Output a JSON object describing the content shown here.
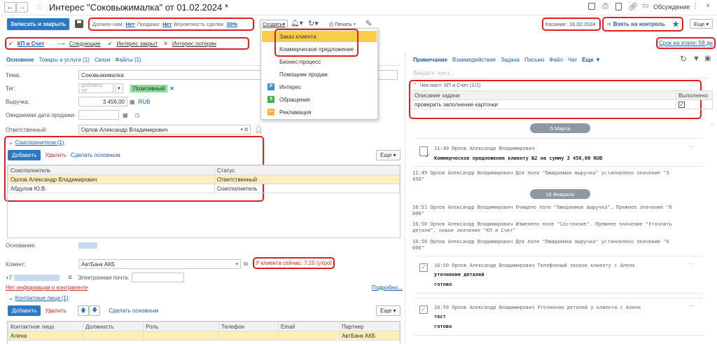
{
  "window": {
    "title": "Интерес \"Соковыжималка\" от 01.02.2024 *",
    "discussion_label": "Обсуждение"
  },
  "toolbar": {
    "save_close": "Записать и закрыть",
    "owes_us_label": "Должен нам:",
    "owes_us_value": "Нет",
    "sales_label": "Продажи:",
    "sales_value": "Нет",
    "probability_label": "Вероятность сделки:",
    "probability_value": "30%",
    "create_label": "Создать",
    "print_label": "Печать",
    "touch_label": "Касание:",
    "touch_value": "16.02.2024",
    "control_label": "Взять на контроль",
    "more_label": "Еще"
  },
  "create_menu": {
    "items": [
      {
        "label": "Заказ клиента",
        "icon": ""
      },
      {
        "label": "Коммерческое предложение",
        "icon": ""
      },
      {
        "label": "Бизнес-процесс",
        "icon": ""
      },
      {
        "label": "Помощник продаж",
        "icon": ""
      },
      {
        "label": "Интерес",
        "icon": "P"
      },
      {
        "label": "Обращение",
        "icon": "Х"
      },
      {
        "label": "Рекламация",
        "icon": "—"
      }
    ]
  },
  "stages": {
    "current": "КП и Счет",
    "next": "Следующие",
    "closed": "Интерес закрыт",
    "lost": "Интерес потерян",
    "stage_time": "Срок на этапе: 58 дн"
  },
  "tabs": [
    "Основное",
    "Товары и услуги (1)",
    "Связи",
    "Файлы (1)"
  ],
  "form": {
    "topic_label": "Тема:",
    "topic_value": "Соковыжималка",
    "tag_label": "Тег:",
    "tag_placeholder": "Добавить тег",
    "tag_value": "Позитивный",
    "revenue_label": "Выручка:",
    "revenue_value": "3 456,00",
    "currency": "RUB",
    "sale_date_label": "Ожидаемая дата продажи:",
    "sale_date_value": ". .",
    "responsible_label": "Ответственный:",
    "responsible_value": "Орлов Александр Владимирович",
    "basis_label": "Основание:",
    "client_label": "Клиент:",
    "client_value": "АвтБанк АКБ",
    "client_time": "У клиента сейчас: 7:10 (утро)",
    "phone_prefix": "+7",
    "email_label": "Электронная почта:",
    "no_info": "Нет информации о контрагенте",
    "more_link": "Подробно..."
  },
  "coexecutors": {
    "title": "Соисполнители (1)",
    "add": "Добавить",
    "delete": "Удалить",
    "make_main": "Сделать основным",
    "more": "Еще",
    "columns": [
      "Соисполнитель",
      "Статус"
    ],
    "rows": [
      [
        "Орлов Александр Владимирович",
        "Ответственный"
      ],
      [
        "Абдулов Ю.В.",
        "Соисполнитель"
      ]
    ]
  },
  "contacts": {
    "title": "Контактные лица (1)",
    "add": "Добавить",
    "delete": "Удалить",
    "make_main": "Сделать основным",
    "more": "Еще",
    "columns": [
      "Контактное лицо",
      "Должность",
      "Роль",
      "Телефон",
      "Email",
      "Партнер"
    ],
    "rows": [
      [
        "Алена",
        "",
        "",
        "",
        "",
        "АвтБанк АКБ"
      ]
    ]
  },
  "right_tabs": [
    "Примечание",
    "Взаимодействие",
    "Задача",
    "Письмо",
    "Файл",
    "Чат",
    "Еще ▼"
  ],
  "note_placeholder": "Введите текст...",
  "checklist": {
    "title": "Чек-лист: КП и Счет (1/1)",
    "columns": [
      "Описание задачи",
      "Выполнено"
    ],
    "rows": [
      {
        "task": "проверить заполнение карточки",
        "done": true
      }
    ]
  },
  "feed": {
    "date1": "5 Марта",
    "card1_header": "11:49 Орлов Александр Владимирович",
    "card1_text": "Коммерческое предложение клиенту №2 на сумму 3 456,00 RUB",
    "log1": "11:49 Орлов Александр Владимирович Для поля \"Ожидаемая выручка\" установлено значение \"3 456\"",
    "date2": "16 Февраля",
    "log2": "16:51 Орлов Александр Владимирович Очищено поле \"Ожидаемая выручка\". Прежнее значение \"6 000\"",
    "log3": "16:50 Орлов Александр Владимирович Изменено поле \"Состояние\". Прежнее значение \"Уточнить детали\", новое значение \"КП и Счет\"",
    "log4": "16:50 Орлов Александр Владимирович Для поля \"Ожидаемая выручка\" установлено значение \"6 000\"",
    "card2_header": "16:50 Орлов Александр Владимирович Телефонный звонок клиенту с Алена",
    "card2_title": "уточнение деталей",
    "card2_status": "готово",
    "card3_header": "16:50 Орлов Александр Владимирович Уточнение деталей у клиента с Алена",
    "card3_title": "тест",
    "card3_status": "готово"
  },
  "colors": {
    "accent": "#2b78c5",
    "highlight": "#e02020",
    "selected_row": "#fdeebb",
    "menu_selected": "#f9cd4a"
  }
}
